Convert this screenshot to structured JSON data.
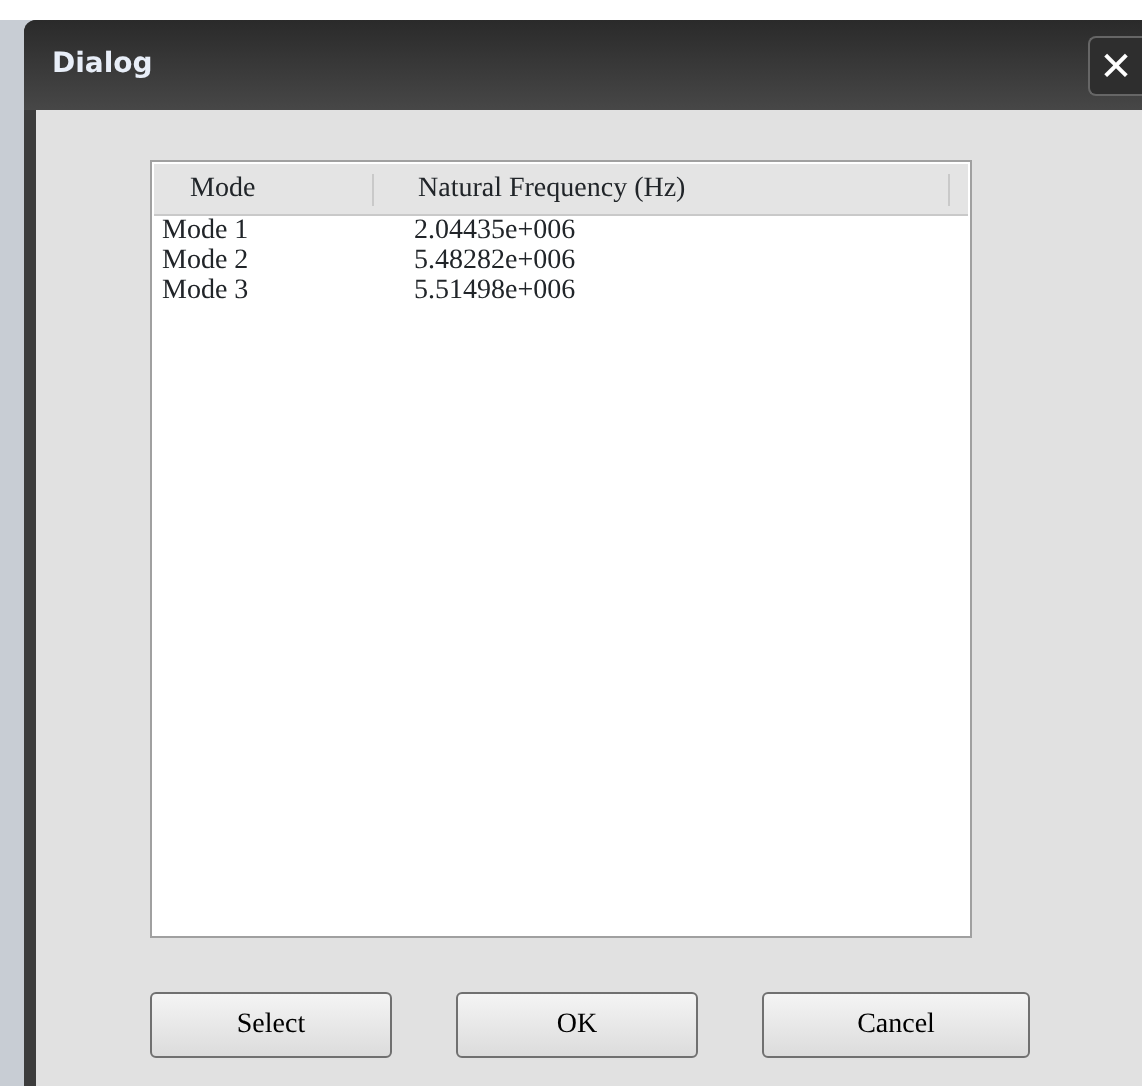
{
  "window": {
    "title": "Dialog",
    "close": "✕"
  },
  "table": {
    "columns": [
      "Mode",
      "Natural Frequency (Hz)"
    ],
    "rows": [
      {
        "cells": [
          "Mode 1",
          "2.04435e+006"
        ]
      },
      {
        "cells": [
          "Mode 2",
          "5.48282e+006"
        ]
      },
      {
        "cells": [
          "Mode 3",
          "5.51498e+006"
        ]
      }
    ]
  },
  "buttons": [
    "Select",
    "OK",
    "Cancel"
  ]
}
